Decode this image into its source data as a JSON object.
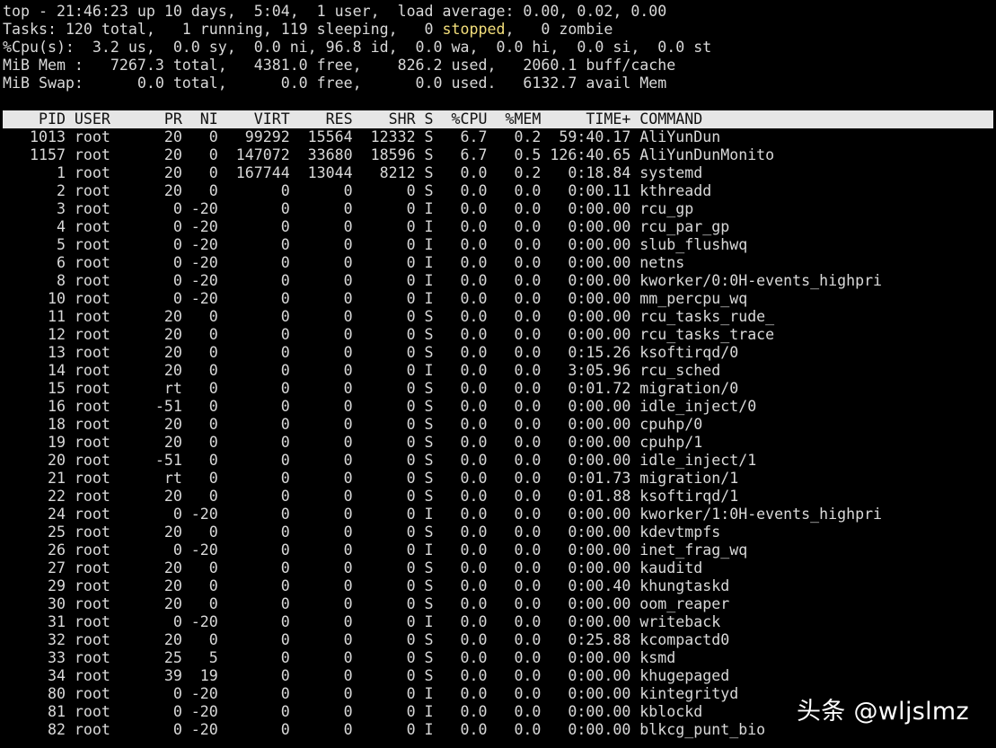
{
  "summary": {
    "line1": "top - 21:46:23 up 10 days,  5:04,  1 user,  load average: 0.00, 0.02, 0.00",
    "tasks_pre": "Tasks: 120 total,   1 running, 119 sleeping,   0 ",
    "tasks_stopped": "stopped",
    "tasks_post": ",   0 zombie",
    "cpu": "%Cpu(s):  3.2 us,  0.0 sy,  0.0 ni, 96.8 id,  0.0 wa,  0.0 hi,  0.0 si,  0.0 st",
    "mem": "MiB Mem :   7267.3 total,   4381.0 free,    826.2 used,   2060.1 buff/cache",
    "swap": "MiB Swap:      0.0 total,      0.0 free,      0.0 used.   6132.7 avail Mem"
  },
  "table": {
    "header": "    PID USER      PR  NI    VIRT    RES    SHR S  %CPU  %MEM     TIME+ COMMAND",
    "rows": [
      "   1013 root      20   0   99292  15564  12332 S   6.7   0.2  59:40.17 AliYunDun",
      "   1157 root      20   0  147072  33680  18596 S   6.7   0.5 126:40.65 AliYunDunMonito",
      "      1 root      20   0  167744  13044   8212 S   0.0   0.2   0:18.84 systemd",
      "      2 root      20   0       0      0      0 S   0.0   0.0   0:00.11 kthreadd",
      "      3 root       0 -20       0      0      0 I   0.0   0.0   0:00.00 rcu_gp",
      "      4 root       0 -20       0      0      0 I   0.0   0.0   0:00.00 rcu_par_gp",
      "      5 root       0 -20       0      0      0 I   0.0   0.0   0:00.00 slub_flushwq",
      "      6 root       0 -20       0      0      0 I   0.0   0.0   0:00.00 netns",
      "      8 root       0 -20       0      0      0 I   0.0   0.0   0:00.00 kworker/0:0H-events_highpri",
      "     10 root       0 -20       0      0      0 I   0.0   0.0   0:00.00 mm_percpu_wq",
      "     11 root      20   0       0      0      0 S   0.0   0.0   0:00.00 rcu_tasks_rude_",
      "     12 root      20   0       0      0      0 S   0.0   0.0   0:00.00 rcu_tasks_trace",
      "     13 root      20   0       0      0      0 S   0.0   0.0   0:15.26 ksoftirqd/0",
      "     14 root      20   0       0      0      0 I   0.0   0.0   3:05.96 rcu_sched",
      "     15 root      rt   0       0      0      0 S   0.0   0.0   0:01.72 migration/0",
      "     16 root     -51   0       0      0      0 S   0.0   0.0   0:00.00 idle_inject/0",
      "     18 root      20   0       0      0      0 S   0.0   0.0   0:00.00 cpuhp/0",
      "     19 root      20   0       0      0      0 S   0.0   0.0   0:00.00 cpuhp/1",
      "     20 root     -51   0       0      0      0 S   0.0   0.0   0:00.00 idle_inject/1",
      "     21 root      rt   0       0      0      0 S   0.0   0.0   0:01.73 migration/1",
      "     22 root      20   0       0      0      0 S   0.0   0.0   0:01.88 ksoftirqd/1",
      "     24 root       0 -20       0      0      0 I   0.0   0.0   0:00.00 kworker/1:0H-events_highpri",
      "     25 root      20   0       0      0      0 S   0.0   0.0   0:00.00 kdevtmpfs",
      "     26 root       0 -20       0      0      0 I   0.0   0.0   0:00.00 inet_frag_wq",
      "     27 root      20   0       0      0      0 S   0.0   0.0   0:00.00 kauditd",
      "     29 root      20   0       0      0      0 S   0.0   0.0   0:00.40 khungtaskd",
      "     30 root      20   0       0      0      0 S   0.0   0.0   0:00.00 oom_reaper",
      "     31 root       0 -20       0      0      0 I   0.0   0.0   0:00.00 writeback",
      "     32 root      20   0       0      0      0 S   0.0   0.0   0:25.88 kcompactd0",
      "     33 root      25   5       0      0      0 S   0.0   0.0   0:00.00 ksmd",
      "     34 root      39  19       0      0      0 S   0.0   0.0   0:00.00 khugepaged",
      "     80 root       0 -20       0      0      0 I   0.0   0.0   0:00.00 kintegrityd",
      "     81 root       0 -20       0      0      0 I   0.0   0.0   0:00.00 kblockd",
      "     82 root       0 -20       0      0      0 I   0.0   0.0   0:00.00 blkcg_punt_bio"
    ]
  },
  "watermark": "头条 @wljslmz",
  "colors": {
    "background": "#000000",
    "text": "#d9d9d9",
    "highlight": "#f4df7b",
    "header_bg": "#e6e6e6",
    "header_text": "#111111"
  }
}
